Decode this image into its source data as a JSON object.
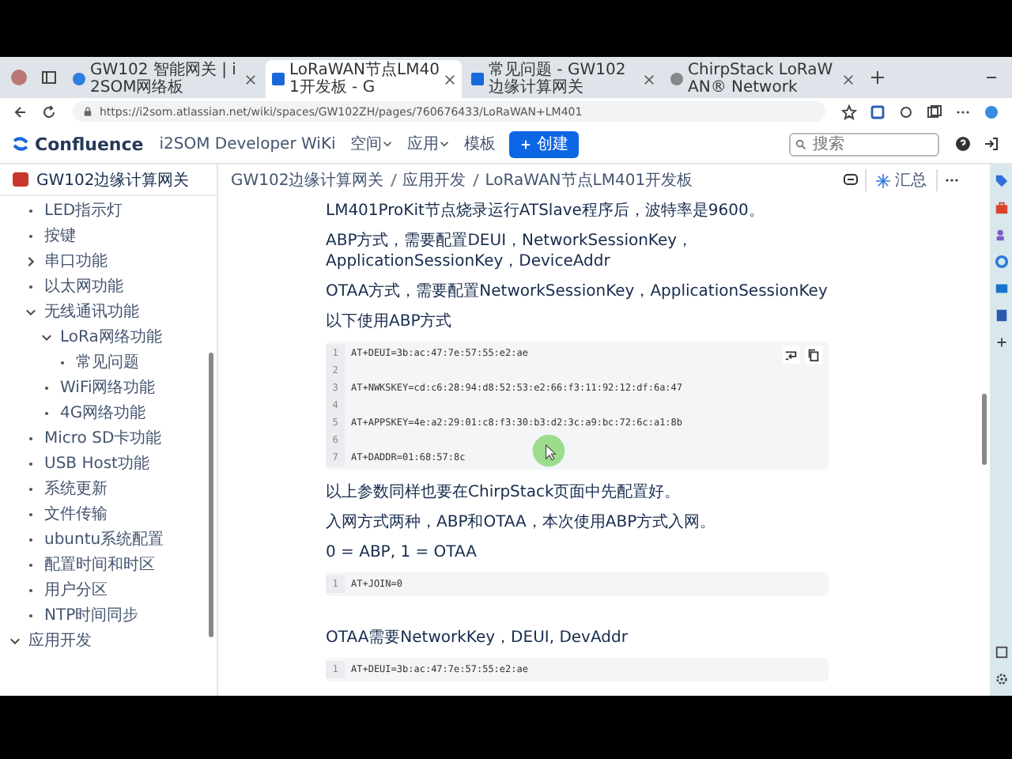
{
  "browser": {
    "tabs": [
      {
        "title": "GW102 智能网关 | i2SOM网络板",
        "selected": false
      },
      {
        "title": "LoRaWAN节点LM401开发板 - G",
        "selected": true
      },
      {
        "title": "常见问题 - GW102边缘计算网关",
        "selected": false
      },
      {
        "title": "ChirpStack LoRaWAN® Network",
        "selected": false
      }
    ],
    "url": "https://i2som.atlassian.net/wiki/spaces/GW102ZH/pages/760676433/LoRaWAN+LM401"
  },
  "header": {
    "product": "Confluence",
    "nav": [
      {
        "label": "i2SOM Developer WiKi",
        "dropdown": false
      },
      {
        "label": "空间",
        "dropdown": true
      },
      {
        "label": "应用",
        "dropdown": true
      },
      {
        "label": "模板",
        "dropdown": false
      }
    ],
    "create_button": "创建",
    "search": {
      "placeholder": "搜索"
    }
  },
  "sidebar": {
    "space_title": "GW102边缘计算网关",
    "tree": [
      {
        "label": "LED指示灯",
        "kind": "leaf"
      },
      {
        "label": "按键",
        "kind": "leaf"
      },
      {
        "label": "串口功能",
        "kind": "branch",
        "expanded": false
      },
      {
        "label": "以太网功能",
        "kind": "leaf"
      },
      {
        "label": "无线通讯功能",
        "kind": "branch",
        "expanded": true,
        "children": [
          {
            "label": "LoRa网络功能",
            "kind": "branch",
            "expanded": true,
            "children": [
              {
                "label": "常见问题",
                "kind": "leaf"
              }
            ]
          },
          {
            "label": "WiFi网络功能",
            "kind": "leaf"
          },
          {
            "label": "4G网络功能",
            "kind": "leaf"
          }
        ]
      },
      {
        "label": "Micro SD卡功能",
        "kind": "leaf"
      },
      {
        "label": "USB Host功能",
        "kind": "leaf"
      },
      {
        "label": "系统更新",
        "kind": "leaf"
      },
      {
        "label": "文件传输",
        "kind": "leaf"
      },
      {
        "label": "ubuntu系统配置",
        "kind": "leaf"
      },
      {
        "label": "配置时间和时区",
        "kind": "leaf"
      },
      {
        "label": "用户分区",
        "kind": "leaf"
      },
      {
        "label": "NTP时间同步",
        "kind": "leaf"
      }
    ],
    "parent_level_items": [
      {
        "label": "应用开发",
        "kind": "branch",
        "expanded": true
      }
    ]
  },
  "page": {
    "breadcrumb": [
      "GW102边缘计算网关",
      "应用开发",
      "LoRaWAN节点LM401开发板"
    ],
    "summary_button": "汇总",
    "blocks": [
      {
        "kind": "paragraph",
        "text": "LM401ProKit节点烧录运行ATSlave程序后，波特率是9600。"
      },
      {
        "kind": "paragraph",
        "text": "ABP方式，需要配置DEUI，NetworkSessionKey，ApplicationSessionKey，DeviceAddr"
      },
      {
        "kind": "paragraph",
        "text": "OTAA方式，需要配置NetworkSessionKey，ApplicationSessionKey"
      },
      {
        "kind": "paragraph",
        "text": "以下使用ABP方式"
      },
      {
        "kind": "code",
        "tools": true,
        "lines": [
          {
            "number": "1",
            "code": "AT+DEUI=3b:ac:47:7e:57:55:e2:ae"
          },
          {
            "number": "2"
          },
          {
            "number": "3",
            "code": "AT+NWKSKEY=cd:c6:28:94:d8:52:53:e2:66:f3:11:92:12:df:6a:47"
          },
          {
            "number": "4"
          },
          {
            "number": "5",
            "code": "AT+APPSKEY=4e:a2:29:01:c8:f3:30:b3:d2:3c:a9:bc:72:6c:a1:8b"
          },
          {
            "number": "6"
          },
          {
            "number": "7",
            "code": "AT+DADDR=01:68:57:8c"
          }
        ]
      },
      {
        "kind": "paragraph",
        "text": "以上参数同样也要在ChirpStack页面中先配置好。"
      },
      {
        "kind": "paragraph",
        "text": "入网方式两种，ABP和OTAA，本次使用ABP方式入网。"
      },
      {
        "kind": "paragraph",
        "text": "0 = ABP, 1 = OTAA"
      },
      {
        "kind": "code",
        "tools": false,
        "lines": [
          {
            "number": "1",
            "code": "AT+JOIN=0"
          }
        ]
      },
      {
        "kind": "spacer"
      },
      {
        "kind": "paragraph",
        "text": "OTAA需要NetworkKey，DEUI, DevAddr"
      },
      {
        "kind": "code",
        "tools": false,
        "lines": [
          {
            "number": "1",
            "code": "AT+DEUI=3b:ac:47:7e:57:55:e2:ae"
          }
        ]
      }
    ]
  }
}
